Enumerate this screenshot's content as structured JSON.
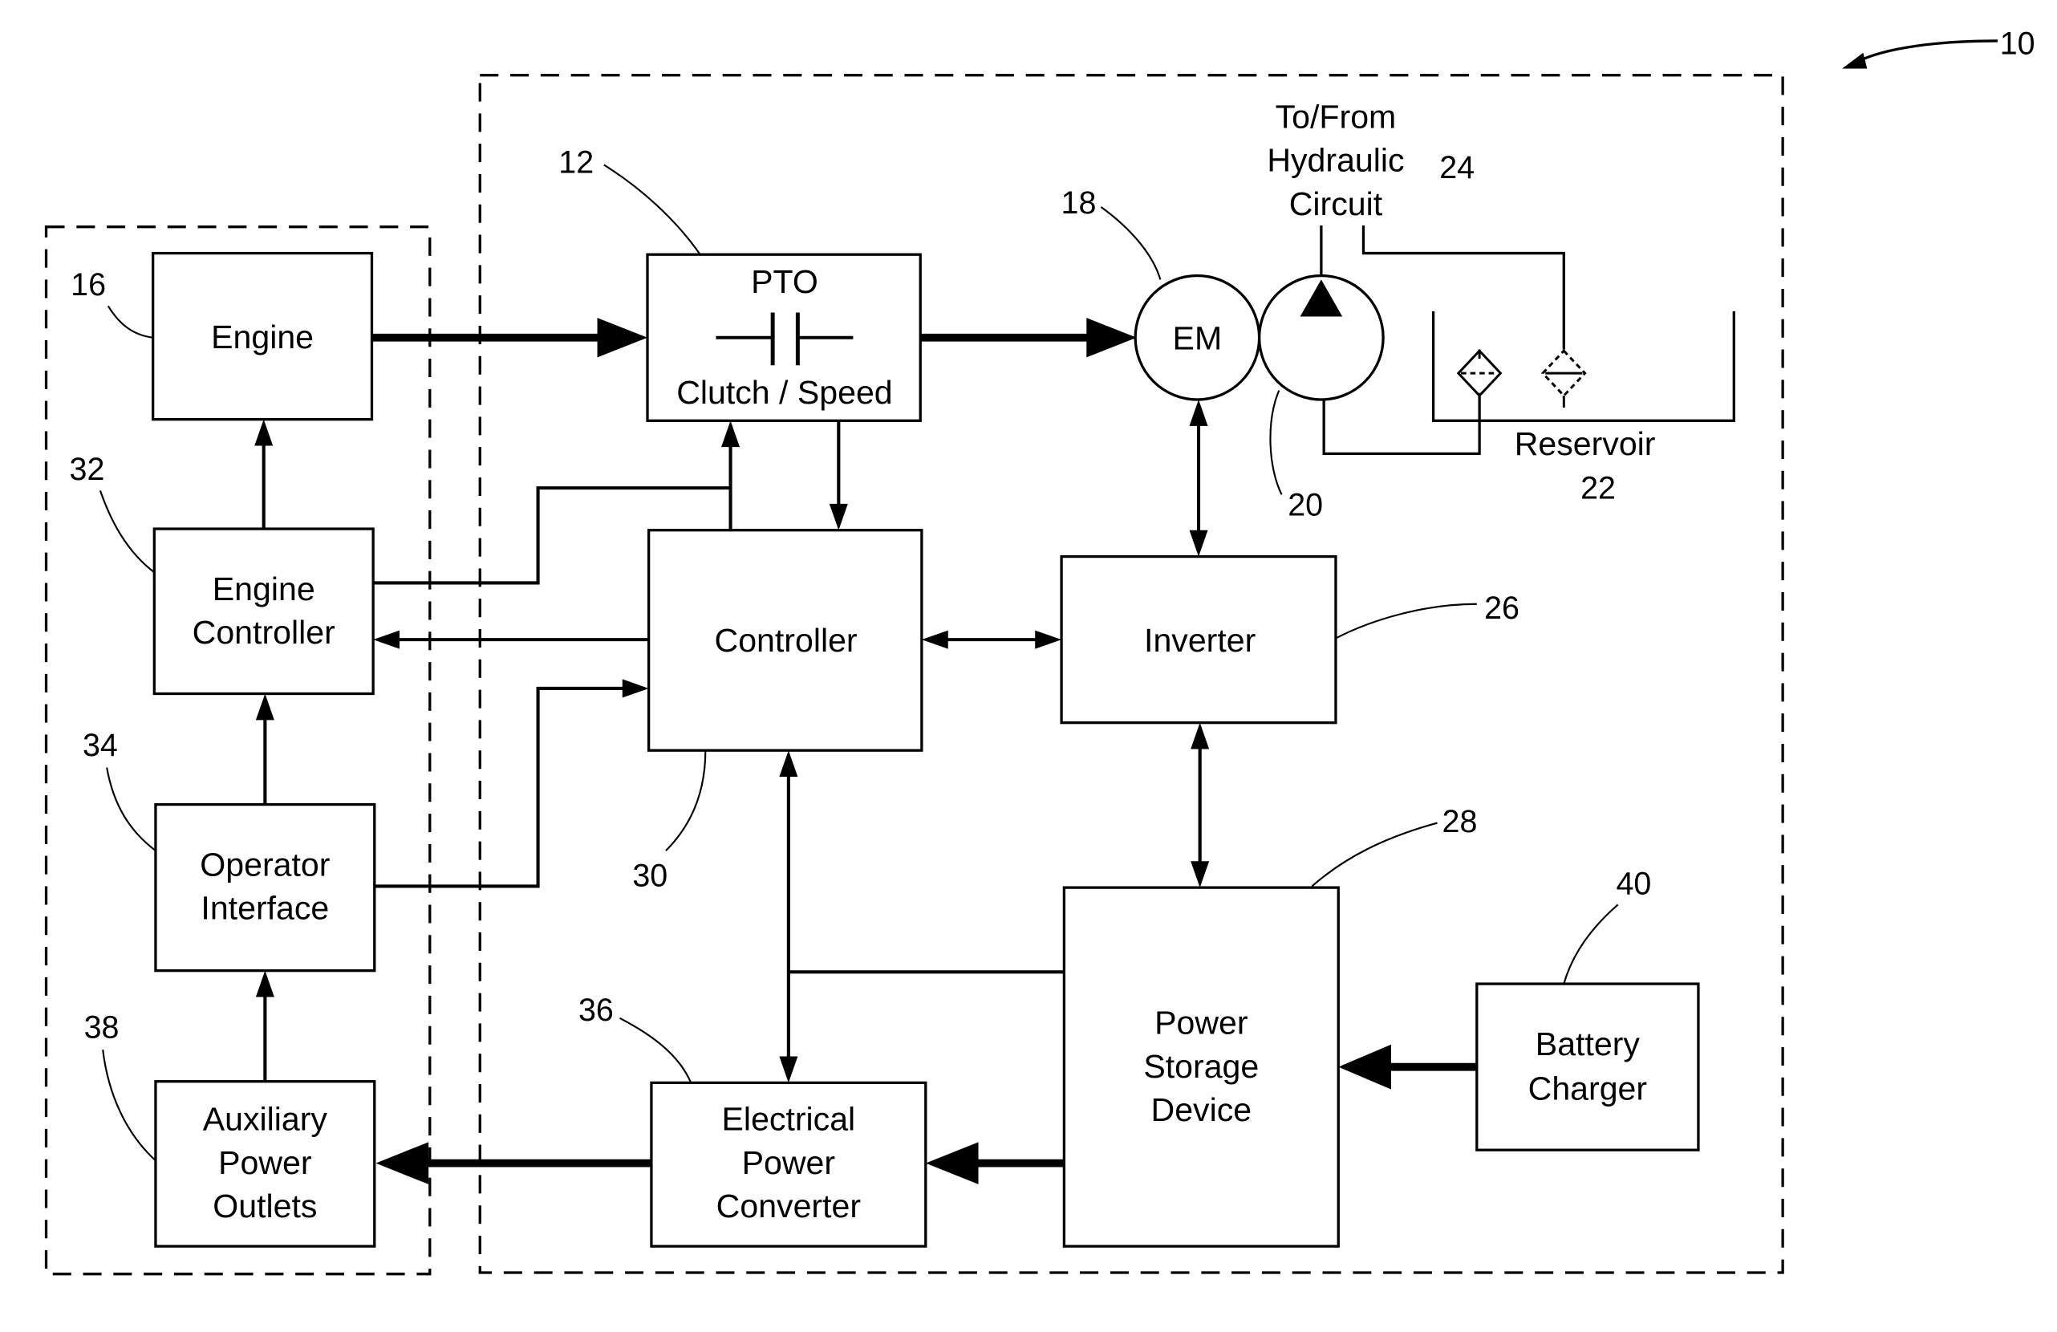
{
  "figure": {
    "system_ref": "10",
    "blocks": {
      "engine": {
        "ref": "16",
        "lines": [
          "Engine"
        ]
      },
      "engine_controller": {
        "ref": "32",
        "lines": [
          "Engine",
          "Controller"
        ]
      },
      "operator_interface": {
        "ref": "34",
        "lines": [
          "Operator",
          "Interface"
        ]
      },
      "auxiliary_power_outlets": {
        "ref": "38",
        "lines": [
          "Auxiliary",
          "Power",
          "Outlets"
        ]
      },
      "pto": {
        "ref": "12",
        "title": "PTO",
        "subtitle": "Clutch / Speed"
      },
      "controller": {
        "ref": "30",
        "lines": [
          "Controller"
        ]
      },
      "electrical_power_converter": {
        "ref": "36",
        "lines": [
          "Electrical",
          "Power",
          "Converter"
        ]
      },
      "em": {
        "ref": "18",
        "label": "EM"
      },
      "pump": {
        "ref": "20"
      },
      "hydraulic_circuit": {
        "ref": "24",
        "lines": [
          "To/From",
          "Hydraulic",
          "Circuit"
        ]
      },
      "reservoir": {
        "ref": "22",
        "label": "Reservoir"
      },
      "inverter": {
        "ref": "26",
        "lines": [
          "Inverter"
        ]
      },
      "power_storage_device": {
        "ref": "28",
        "lines": [
          "Power",
          "Storage",
          "Device"
        ]
      },
      "battery_charger": {
        "ref": "40",
        "lines": [
          "Battery",
          "Charger"
        ]
      }
    }
  }
}
